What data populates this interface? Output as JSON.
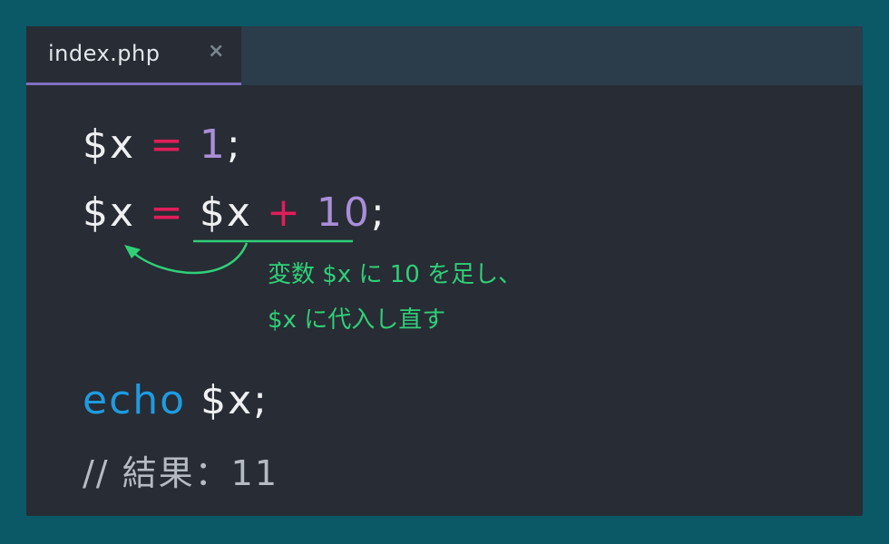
{
  "tab": {
    "label": "index.php",
    "close_glyph": "×"
  },
  "code": {
    "line1": {
      "var": "$x",
      "op": "=",
      "value": "1",
      "end": ";"
    },
    "line2": {
      "var": "$x",
      "op": "=",
      "var2": "$x",
      "op2": "+",
      "value": "10",
      "end": ";"
    },
    "line3": {
      "keyword": "echo",
      "var": "$x",
      "end": ";"
    },
    "line4": "// 結果：11"
  },
  "annotation": {
    "line1": "変数 $x に 10 を足し、",
    "line2": "$x に代入し直す"
  },
  "colors": {
    "background": "#0b5866",
    "editor": "#282c34",
    "tabbar": "#2b3c4b",
    "operator": "#e11d5a",
    "number": "#a98ed8",
    "keyword": "#1e9be0",
    "annotation": "#2fcf78",
    "tab_underline": "#7f6fc0"
  },
  "icons": [
    "close-icon",
    "curved-arrow-icon"
  ]
}
